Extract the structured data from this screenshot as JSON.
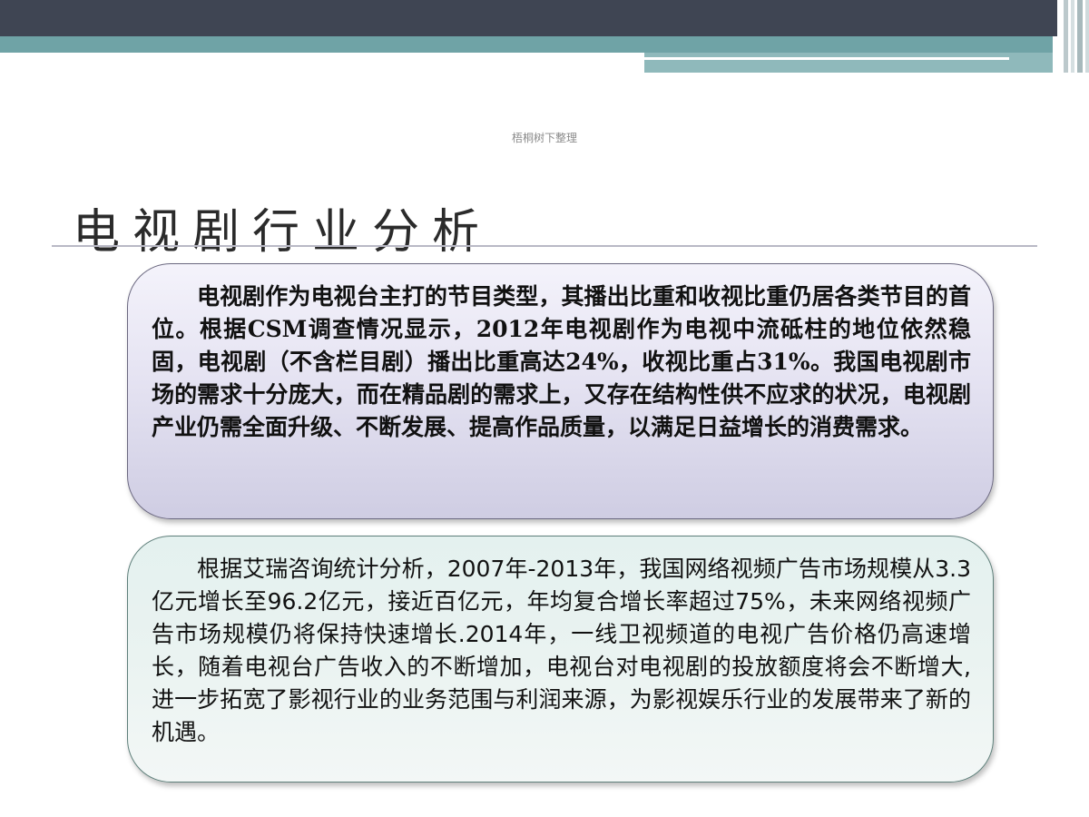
{
  "watermark": "梧桐树下整理",
  "slide": {
    "title": "电视剧行业分析",
    "paragraph1": "电视剧作为电视台主打的节目类型，其播出比重和收视比重仍居各类节目的首位。根据CSM调查情况显示，2012年电视剧作为电视中流砥柱的地位依然稳固，电视剧（不含栏目剧）播出比重高达24%，收视比重占31%。我国电视剧市场的需求十分庞大，而在精品剧的需求上，又存在结构性供不应求的状况，电视剧产业仍需全面升级、不断发展、提高作品质量，以满足日益增长的消费需求。",
    "paragraph2": "根据艾瑞咨询统计分析，2007年-2013年，我国网络视频广告市场规模从3.3亿元增长至96.2亿元，接近百亿元，年均复合增长率超过75%，未来网络视频广告市场规模仍将保持快速增长.2014年，一线卫视频道的电视广告价格仍高速增长，随着电视台广告收入的不断增加，电视台对电视剧的投放额度将会不断增大,进一步拓宽了影视行业的业务范围与利润来源，为影视娱乐行业的发展带来了新的机遇。"
  },
  "colors": {
    "band_dark": "#3f4553",
    "band_teal": "#6fa3a6",
    "box1_fill": "#e5e3f2",
    "box2_fill": "#eaf3f1"
  }
}
